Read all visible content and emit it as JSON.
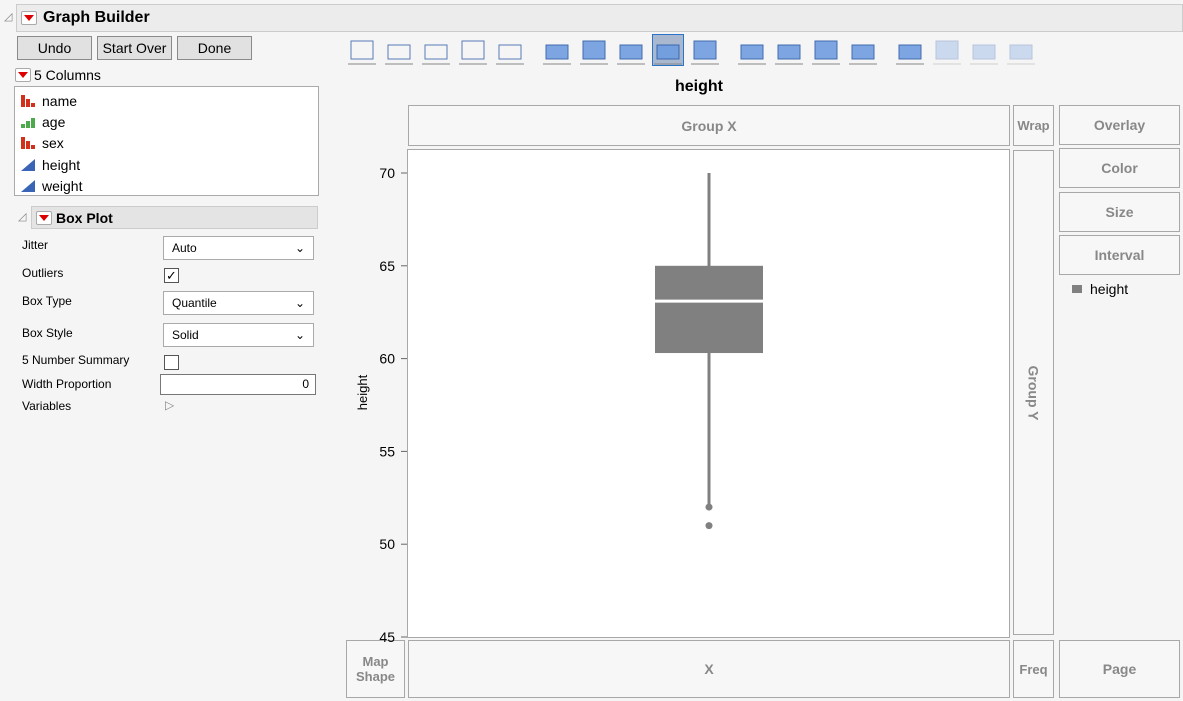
{
  "header": {
    "title": "Graph Builder"
  },
  "buttons": {
    "undo": "Undo",
    "start_over": "Start Over",
    "done": "Done"
  },
  "columns": {
    "title": "5 Columns",
    "items": [
      {
        "label": "name",
        "type": "nominal"
      },
      {
        "label": "age",
        "type": "ordinal"
      },
      {
        "label": "sex",
        "type": "nominal"
      },
      {
        "label": "height",
        "type": "continuous"
      },
      {
        "label": "weight",
        "type": "continuous"
      }
    ]
  },
  "boxplot": {
    "title": "Box Plot",
    "jitter_label": "Jitter",
    "jitter": "Auto",
    "outliers_label": "Outliers",
    "outliers_checked": true,
    "box_type_label": "Box Type",
    "box_type": "Quantile",
    "box_style_label": "Box Style",
    "box_style": "Solid",
    "five_num_label": "5 Number Summary",
    "five_num_checked": false,
    "width_prop_label": "Width Proportion",
    "width_prop": "0",
    "variables_label": "Variables"
  },
  "toolbar": [
    "points",
    "smoother",
    "line-of-fit",
    "ellipse",
    "contour",
    "line",
    "bar",
    "area",
    "box-plot",
    "histogram",
    "heatmap",
    "pie",
    "treemap",
    "mosaic",
    "caption-box",
    "formula",
    "map-shapes",
    "parallel"
  ],
  "graph": {
    "title": "height",
    "ylabel": "height"
  },
  "zones": {
    "group_x": "Group X",
    "wrap": "Wrap",
    "overlay": "Overlay",
    "color": "Color",
    "size": "Size",
    "interval": "Interval",
    "group_y": "Group Y",
    "map_shape": "Map\nShape",
    "x": "X",
    "freq": "Freq",
    "page": "Page"
  },
  "legend": {
    "item": "height"
  },
  "chart_data": {
    "type": "box",
    "ylabel": "height",
    "ylim": [
      45,
      70
    ],
    "yticks": [
      45,
      50,
      55,
      60,
      65,
      70
    ],
    "whisker_low": 52,
    "q1": 60.3,
    "median": 63.1,
    "q3": 65,
    "whisker_high": 70,
    "outliers": [
      52,
      51
    ]
  },
  "colors": {
    "box": "#808080",
    "accent": "#d00000"
  }
}
